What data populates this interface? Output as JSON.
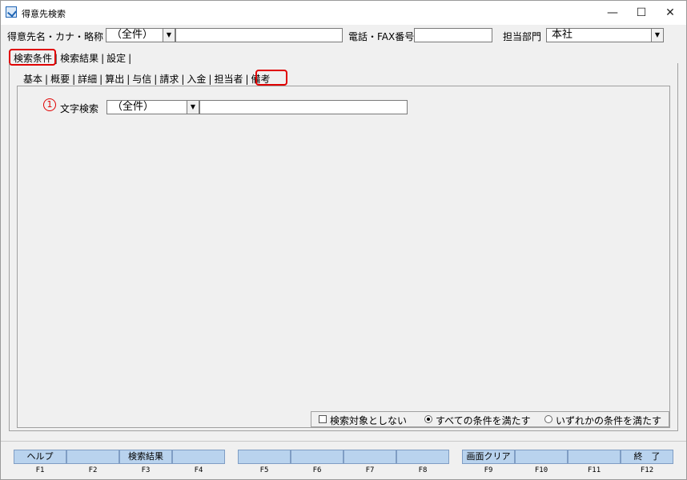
{
  "window": {
    "title": "得意先検索"
  },
  "header": {
    "name_label": "得意先名・カナ・略称",
    "name_scope": "（全件）",
    "phone_label": "電話・FAX番号",
    "dept_label": "担当部門",
    "dept_value": "本社"
  },
  "main_tabs": [
    "検索条件",
    "検索結果",
    "設定"
  ],
  "sub_tabs": [
    "基本",
    "概要",
    "詳細",
    "算出",
    "与信",
    "請求",
    "入金",
    "担当者",
    "備考"
  ],
  "content": {
    "marker": "1",
    "text_search_label": "文字検索",
    "text_search_scope": "（全件）"
  },
  "options": {
    "exclude_label": "検索対象としない",
    "all_label": "すべての条件を満たす",
    "any_label": "いずれかの条件を満たす"
  },
  "fkeys": [
    {
      "key": "F1",
      "label": "ヘルプ"
    },
    {
      "key": "F2",
      "label": ""
    },
    {
      "key": "F3",
      "label": "検索結果"
    },
    {
      "key": "F4",
      "label": ""
    },
    {
      "key": "F5",
      "label": ""
    },
    {
      "key": "F6",
      "label": ""
    },
    {
      "key": "F7",
      "label": ""
    },
    {
      "key": "F8",
      "label": ""
    },
    {
      "key": "F9",
      "label": "画面クリア"
    },
    {
      "key": "F10",
      "label": ""
    },
    {
      "key": "F11",
      "label": ""
    },
    {
      "key": "F12",
      "label": "終　了"
    }
  ],
  "colors": {
    "highlight": "#e00000",
    "fkey_bg": "#b9d3ee"
  }
}
